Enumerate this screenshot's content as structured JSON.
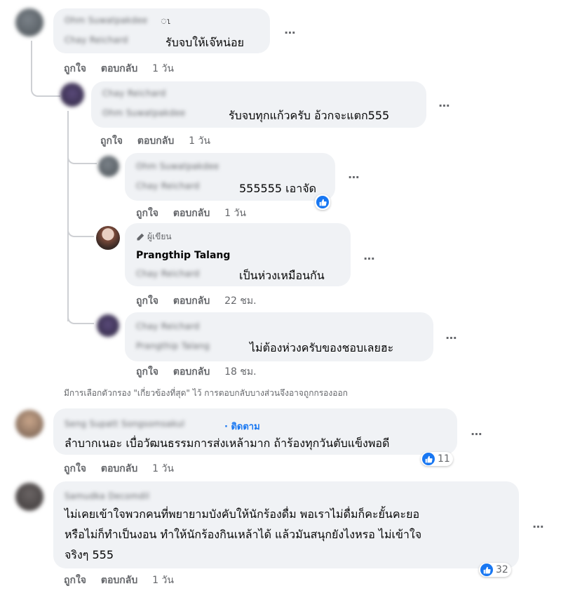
{
  "colors": {
    "bubble": "#f0f2f5",
    "accent": "#1877f2",
    "muted": "#65676b",
    "line": "#ced0d4"
  },
  "actions": {
    "like": "ถูกใจ",
    "reply": "ตอบกลับ"
  },
  "more_icon": "⋯",
  "comments": [
    {
      "id": "c1",
      "name": "Ohm Suwatpakdee",
      "tag": "Chay Reichard",
      "text": "รับจบให้เจ๊หน่อย",
      "time": "1 วัน"
    },
    {
      "id": "c2",
      "name": "Chay Reichard",
      "tag": "Ohm Suwatpakdee",
      "text": "รับจบทุกแก้วครับ อ้วกจะแตก555",
      "time": "1 วัน"
    },
    {
      "id": "c3",
      "name": "Ohm Suwatpakdee",
      "tag": "Chay Reichard",
      "text": "555555 เอาจัด",
      "time": "1 วัน",
      "reaction": "like-icon"
    },
    {
      "id": "c4",
      "author_badge": "ผู้เขียน",
      "name": "Prangthip Talang",
      "tag": "Chay Reichard",
      "text": "เป็นห่วงเหมือนกัน",
      "time": "22 ชม."
    },
    {
      "id": "c5",
      "name": "Chay Reichard",
      "tag": "Prangthip Talang",
      "text": "ไม่ต้องห่วงครับของชอบเลยฮะ",
      "time": "18 ชม."
    },
    {
      "id": "c6",
      "name": "Seng Supatt Songsomsakul",
      "follow": "ติดตาม",
      "text": "ลำบากเนอะ เบื่อวัฒนธรรมการส่งเหล้ามาก ถ้าร้องทุกวันตับแข็งพอดี",
      "time": "1 วัน",
      "reaction_count": "11"
    },
    {
      "id": "c7",
      "name": "Samudka Decomdil",
      "lines": [
        "ไม่เคยเข้าใจพวกคนที่พยายามบังคับให้นักร้องดื่ม พอเราไม่ดื่มก็คะยั้นคะยอ",
        "หรือไม่ก็ทำเป็นงอน ทำให้นักร้องกินเหล้าได้ แล้วมันสนุกยังไงหรอ ไม่เข้าใจ",
        "จริงๆ 555"
      ],
      "time": "1 วัน",
      "reaction_count": "32"
    }
  ],
  "filter_notice": "มีการเลือกตัวกรอง \"เกี่ยวข้องที่สุด\" ไว้ การตอบกลับบางส่วนจึงอาจถูกกรองออก"
}
